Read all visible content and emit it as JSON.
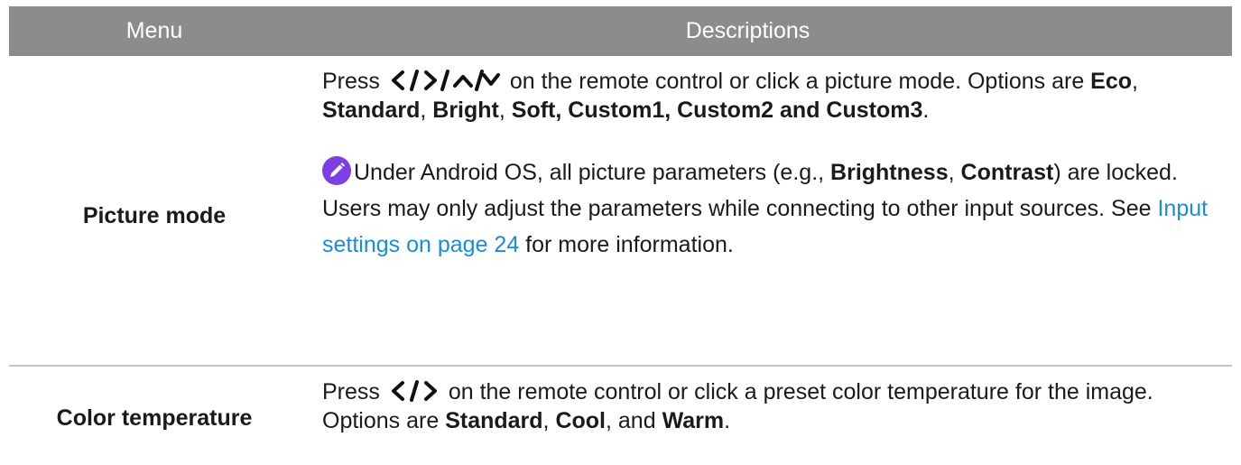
{
  "header": {
    "menu": "Menu",
    "descriptions": "Descriptions"
  },
  "rows": [
    {
      "menu": "Picture mode",
      "desc": {
        "press": "Press",
        "after_arrows": " on the remote control or click a picture mode. Options are ",
        "opt1": "Eco",
        "sep1": ", ",
        "opt2": "Standard",
        "sep2": ", ",
        "opt3": "Bright",
        "sep3": ", ",
        "opt4": "Soft, Custom1, Custom2 and Custom3",
        "end": ".",
        "note_a": "Under Android OS, all picture parameters (e.g., ",
        "note_b": "Brightness",
        "note_c": ", ",
        "note_d": "Contrast",
        "note_e": ") are locked. Users may only adjust the parameters while connecting to other input sources. See ",
        "note_link": "Input settings on page 24",
        "note_f": " for more information."
      },
      "note_icon": "pencil-note-icon",
      "arrow_icons": "left-right-up-down-arrow-icons"
    },
    {
      "menu": "Color temperature",
      "desc": {
        "press": "Press",
        "after_arrows": " on the remote control or click a preset color temperature for the image. Options are ",
        "opt1": "Standard",
        "sep1": ", ",
        "opt2": "Cool",
        "sep2": ", and ",
        "opt3": "Warm",
        "end": "."
      },
      "arrow_icons": "left-right-arrow-icons"
    }
  ],
  "colors": {
    "header_bg": "#8c8c8c",
    "link": "#1a8cd8",
    "icon": "#7b3fe4"
  }
}
